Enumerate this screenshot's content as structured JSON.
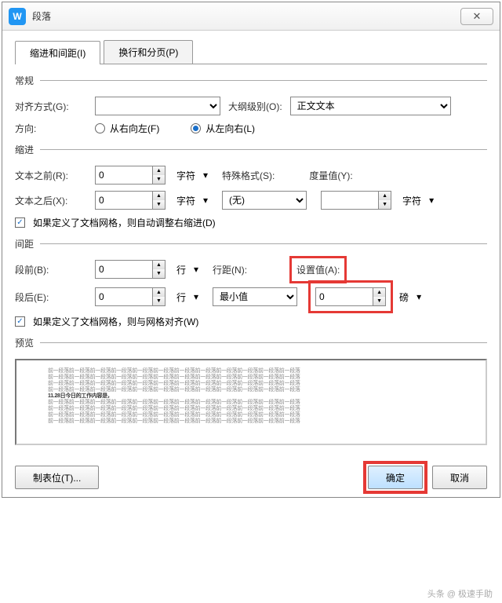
{
  "titlebar": {
    "title": "段落"
  },
  "tabs": {
    "indent_spacing": "缩进和间距(I)",
    "line_page": "换行和分页(P)"
  },
  "groups": {
    "general": "常规",
    "indent": "缩进",
    "spacing": "间距",
    "preview": "预览"
  },
  "general": {
    "align_label": "对齐方式(G):",
    "align_value": "",
    "outline_label": "大纲级别(O):",
    "outline_value": "正文文本",
    "direction_label": "方向:",
    "rtl_label": "从右向左(F)",
    "ltr_label": "从左向右(L)"
  },
  "indent": {
    "before_label": "文本之前(R):",
    "before_value": "0",
    "after_label": "文本之后(X):",
    "after_value": "0",
    "unit_chars": "字符",
    "special_label": "特殊格式(S):",
    "special_value": "(无)",
    "measure_label": "度量值(Y):",
    "measure_value": "",
    "auto_adjust_label": "如果定义了文档网格，则自动调整右缩进(D)"
  },
  "spacing": {
    "before_label": "段前(B):",
    "before_value": "0",
    "after_label": "段后(E):",
    "after_value": "0",
    "unit_lines": "行",
    "line_spacing_label": "行距(N):",
    "line_spacing_value": "最小值",
    "set_value_label": "设置值(A):",
    "set_value": "0",
    "set_value_unit": "磅",
    "snap_grid_label": "如果定义了文档网格，则与网格对齐(W)"
  },
  "preview_text": "前一段落前一段落前一段落前一段落前一段落前一段落前一段落前一段落前一段落前一段落前一段落前一段落",
  "preview_mid": "11.28日今日的工作内容是，",
  "footer": {
    "tabs_btn": "制表位(T)...",
    "ok": "确定",
    "cancel": "取消"
  },
  "watermark": "头条 @ 极速手助"
}
